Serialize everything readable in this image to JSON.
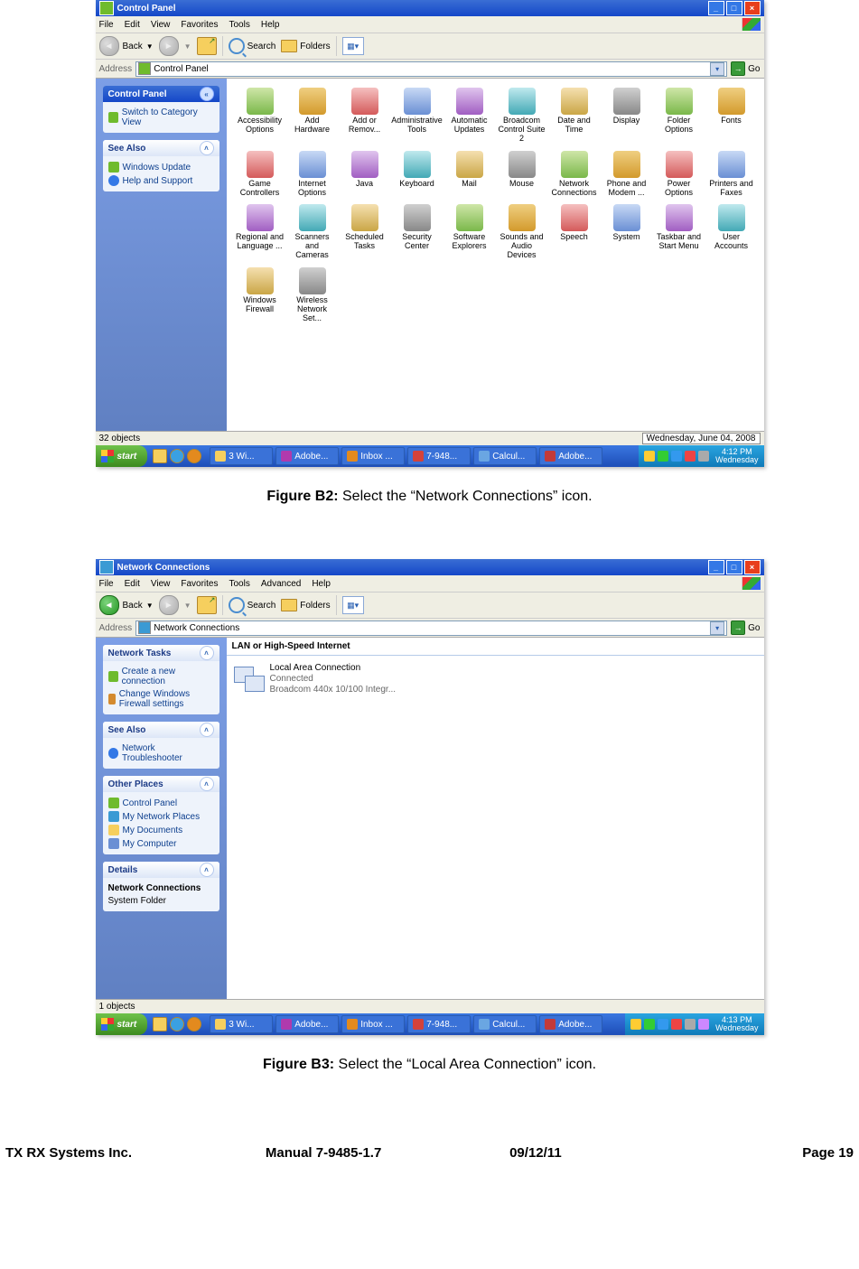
{
  "caption_b2": {
    "bold": "Figure B2:",
    "rest": " Select the “Network Connections” icon."
  },
  "caption_b3": {
    "bold": "Figure B3:",
    "rest": " Select the “Local Area Connection” icon."
  },
  "footer": {
    "company": "TX RX Systems Inc.",
    "manual": "Manual 7-9485-1.7",
    "date": "09/12/11",
    "page": "Page 19"
  },
  "s1": {
    "title": "Control Panel",
    "menus": [
      "File",
      "Edit",
      "View",
      "Favorites",
      "Tools",
      "Help"
    ],
    "tb_back": "Back",
    "tb_search": "Search",
    "tb_folders": "Folders",
    "addr_label": "Address",
    "addr_value": "Control Panel",
    "go": "Go",
    "panel_cp": "Control Panel",
    "panel_cp_link": "Switch to Category View",
    "panel_see": "See Also",
    "see_items": [
      "Windows Update",
      "Help and Support"
    ],
    "icons": [
      "Accessibility Options",
      "Add Hardware",
      "Add or Remov...",
      "Administrative Tools",
      "Automatic Updates",
      "Broadcom Control Suite 2",
      "Date and Time",
      "Display",
      "Folder Options",
      "Fonts",
      "Game Controllers",
      "Internet Options",
      "Java",
      "Keyboard",
      "Mail",
      "Mouse",
      "Network Connections",
      "Phone and Modem ...",
      "Power Options",
      "Printers and Faxes",
      "Regional and Language ...",
      "Scanners and Cameras",
      "Scheduled Tasks",
      "Security Center",
      "Software Explorers",
      "Sounds and Audio Devices",
      "Speech",
      "System",
      "Taskbar and Start Menu",
      "User Accounts",
      "Windows Firewall",
      "Wireless Network Set..."
    ],
    "status_count": "32 objects",
    "status_date": "Wednesday, June 04, 2008",
    "start": "start",
    "tasks": [
      "3 Wi...",
      "Adobe...",
      "Inbox ...",
      "7-948...",
      "Calcul...",
      "Adobe..."
    ],
    "clock": {
      "time": "4:12 PM",
      "day": "Wednesday"
    }
  },
  "s2": {
    "title": "Network Connections",
    "menus": [
      "File",
      "Edit",
      "View",
      "Favorites",
      "Tools",
      "Advanced",
      "Help"
    ],
    "tb_back": "Back",
    "tb_search": "Search",
    "tb_folders": "Folders",
    "addr_label": "Address",
    "addr_value": "Network Connections",
    "go": "Go",
    "panel_net": "Network Tasks",
    "net_items": [
      "Create a new connection",
      "Change Windows Firewall settings"
    ],
    "panel_see": "See Also",
    "see_items": [
      "Network Troubleshooter"
    ],
    "panel_other": "Other Places",
    "other_items": [
      "Control Panel",
      "My Network Places",
      "My Documents",
      "My Computer"
    ],
    "panel_details": "Details",
    "details_item": "Network Connections",
    "details_sub": "System Folder",
    "section": "LAN or High-Speed Internet",
    "conn": {
      "name": "Local Area Connection",
      "state": "Connected",
      "dev": "Broadcom 440x 10/100 Integr..."
    },
    "status_count": "1 objects",
    "start": "start",
    "tasks": [
      "3 Wi...",
      "Adobe...",
      "Inbox ...",
      "7-948...",
      "Calcul...",
      "Adobe..."
    ],
    "clock": {
      "time": "4:13 PM",
      "day": "Wednesday"
    }
  }
}
